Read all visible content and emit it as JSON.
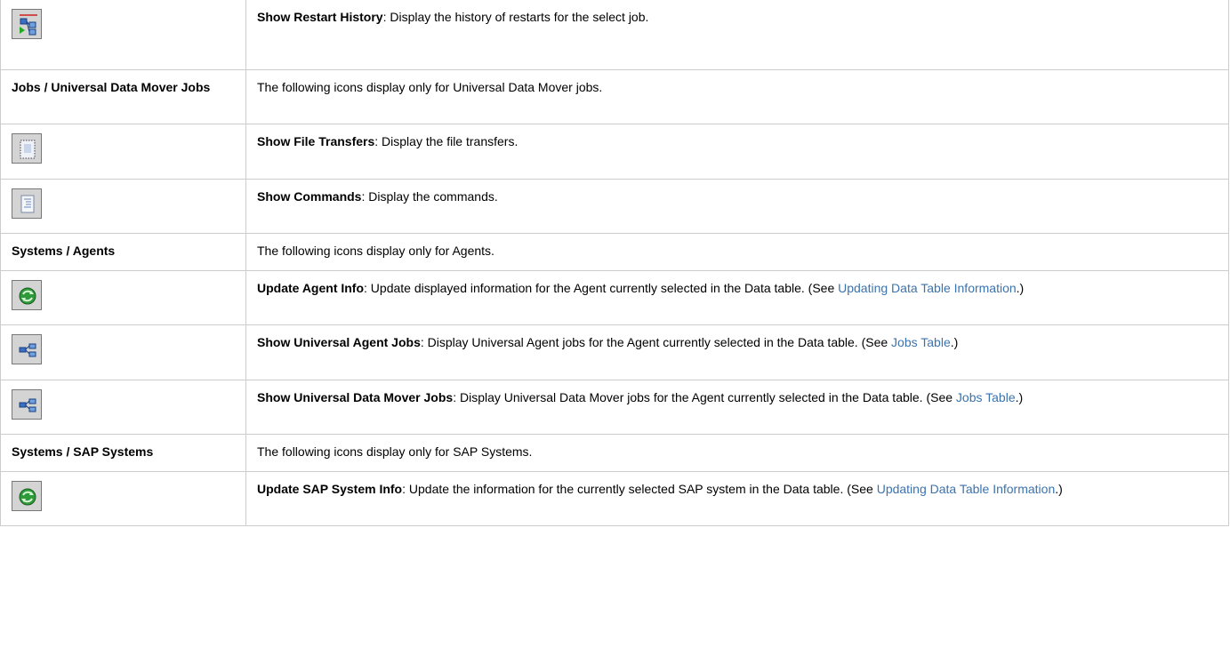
{
  "rows": [
    {
      "icon": "restart-history-icon",
      "title": "Show Restart History",
      "desc": ": Display the history of restarts for the select job."
    },
    {
      "header": "Jobs / Universal Data Mover Jobs",
      "desc": "The following icons display only for Universal Data Mover jobs."
    },
    {
      "icon": "file-transfers-icon",
      "title": "Show File Transfers",
      "desc": ": Display the file transfers."
    },
    {
      "icon": "commands-icon",
      "title": "Show Commands",
      "desc": ": Display the commands."
    },
    {
      "header": "Systems / Agents",
      "desc": "The following icons display only for Agents."
    },
    {
      "icon": "update-agent-icon",
      "title": "Update Agent Info",
      "desc": ": Update displayed information for the Agent currently selected in the Data table. (See ",
      "link": "Updating Data Table Information",
      "after": ".)"
    },
    {
      "icon": "agent-jobs-icon",
      "title": "Show Universal Agent Jobs",
      "desc": ": Display Universal Agent jobs for the Agent currently selected in the Data table. (See ",
      "link": "Jobs Table",
      "after": ".)"
    },
    {
      "icon": "data-mover-jobs-icon",
      "title": "Show Universal Data Mover Jobs",
      "desc": ": Display Universal Data Mover jobs for the Agent currently selected in the Data table. (See ",
      "link": "Jobs Table",
      "after": ".)"
    },
    {
      "header": "Systems / SAP Systems",
      "desc": "The following icons display only for SAP Systems."
    },
    {
      "icon": "update-sap-icon",
      "title": "Update SAP System Info",
      "desc": ": Update the information for the currently selected SAP system in the Data table. (See ",
      "link": "Updating Data Table Information",
      "after": ".)"
    }
  ]
}
